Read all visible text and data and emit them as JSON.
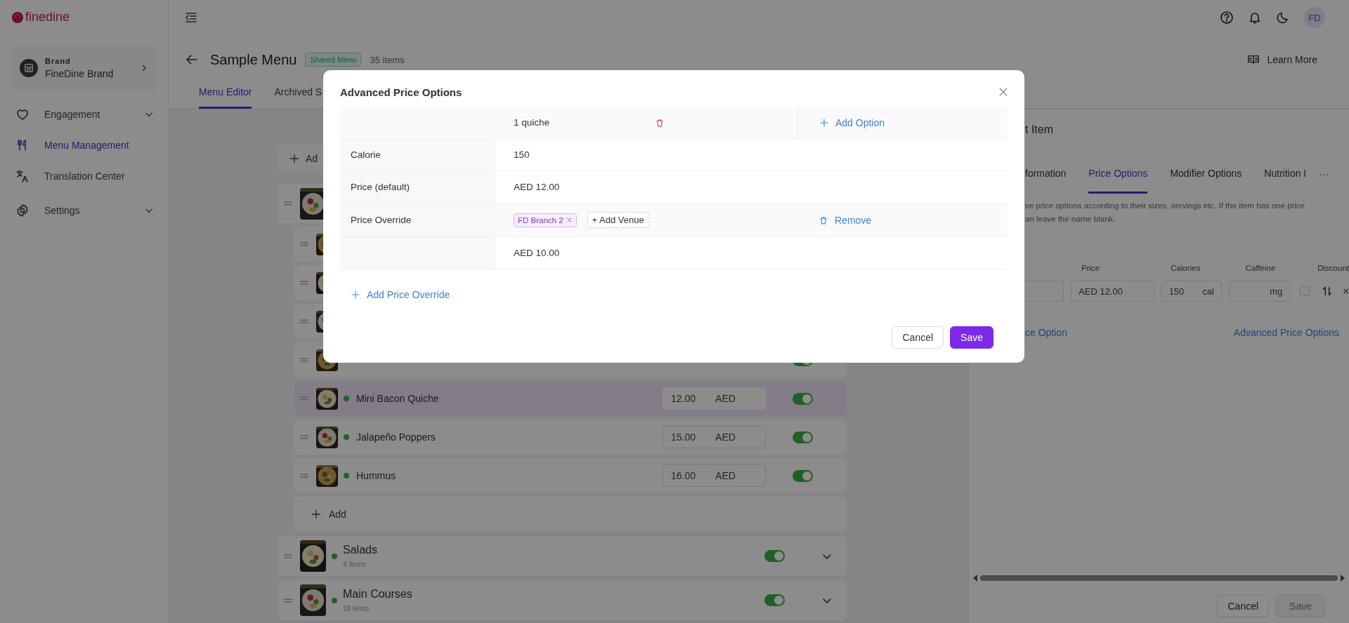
{
  "sidebar": {
    "logo": "finedine",
    "brand": {
      "label": "Brand",
      "name": "FineDine Brand"
    },
    "groups": [
      [
        {
          "label": "Engagement",
          "expandable": true,
          "selected": false
        },
        {
          "label": "Menu Management",
          "expandable": false,
          "selected": true
        },
        {
          "label": "Translation Center",
          "expandable": false,
          "selected": false
        }
      ],
      [
        {
          "label": "Settings",
          "expandable": true,
          "selected": false
        }
      ]
    ]
  },
  "topbar": {
    "avatar": "FD"
  },
  "page": {
    "title": "Sample Menu",
    "badge": "Shared Menu",
    "count": "35 items",
    "learn_more": "Learn More",
    "tabs": [
      {
        "label": "Menu Editor",
        "selected": true
      },
      {
        "label": "Archived S",
        "selected": false
      }
    ]
  },
  "menu": {
    "add_label": "Ad",
    "categories": [
      {
        "kind": "covered",
        "children": [
          {
            "kind": "covered",
            "selected": false
          },
          {
            "kind": "covered",
            "selected": false
          },
          {
            "kind": "covered",
            "selected": false
          },
          {
            "kind": "covered",
            "selected": false,
            "on": true
          },
          {
            "kind": "item",
            "name": "Mini Bacon Quiche",
            "price": "12.00",
            "currency": "AED",
            "active": true,
            "on": true,
            "selected": true
          },
          {
            "kind": "item",
            "name": "Jalapeño Poppers",
            "price": "15.00",
            "currency": "AED",
            "active": true,
            "on": true,
            "selected": false
          },
          {
            "kind": "item",
            "name": "Hummus",
            "price": "16.00",
            "currency": "AED",
            "active": true,
            "on": true,
            "selected": false
          }
        ],
        "add_label": "Add"
      },
      {
        "kind": "category",
        "name": "Salads",
        "count": "4 items",
        "active": true,
        "on": true,
        "expanded": false
      },
      {
        "kind": "category",
        "name": "Main Courses",
        "count": "18 items",
        "active": true,
        "on": true,
        "expanded": false
      }
    ]
  },
  "item_panel": {
    "title": "t Item",
    "tabs": [
      {
        "label": "formation",
        "selected": false
      },
      {
        "label": "Price Options",
        "selected": true
      },
      {
        "label": "Modifier Options",
        "selected": false
      },
      {
        "label": "Nutrition I",
        "selected": false
      }
    ],
    "more": "···",
    "description": "ve price options according to their sizes, servings etc. If the item has one price\nan leave the name blank.",
    "columns": [
      "Price",
      "Calories",
      "Caffeine",
      "Discount"
    ],
    "option": {
      "price": "AED 12.00",
      "calories": "150",
      "calories_unit": "cal",
      "caffeine_unit": "mg",
      "discount": false
    },
    "add_option": "ce Option",
    "advanced": "Advanced Price Options",
    "cancel": "Cancel",
    "save": "Save",
    "save_disabled": true
  },
  "modal": {
    "title": "Advanced Price Options",
    "option_name": "1 quiche",
    "add_option": "Add Option",
    "rows": [
      {
        "label": "Calorie",
        "value": "150"
      },
      {
        "label": "Price (default)",
        "value": "AED 12.00"
      }
    ],
    "overrides": [
      {
        "label": "Price Override",
        "venues": [
          "FD Branch 2"
        ],
        "add_venue": "+ Add Venue",
        "remove": "Remove",
        "value": "AED 10.00"
      }
    ],
    "add_override": "Add Price Override",
    "cancel": "Cancel",
    "save": "Save"
  }
}
